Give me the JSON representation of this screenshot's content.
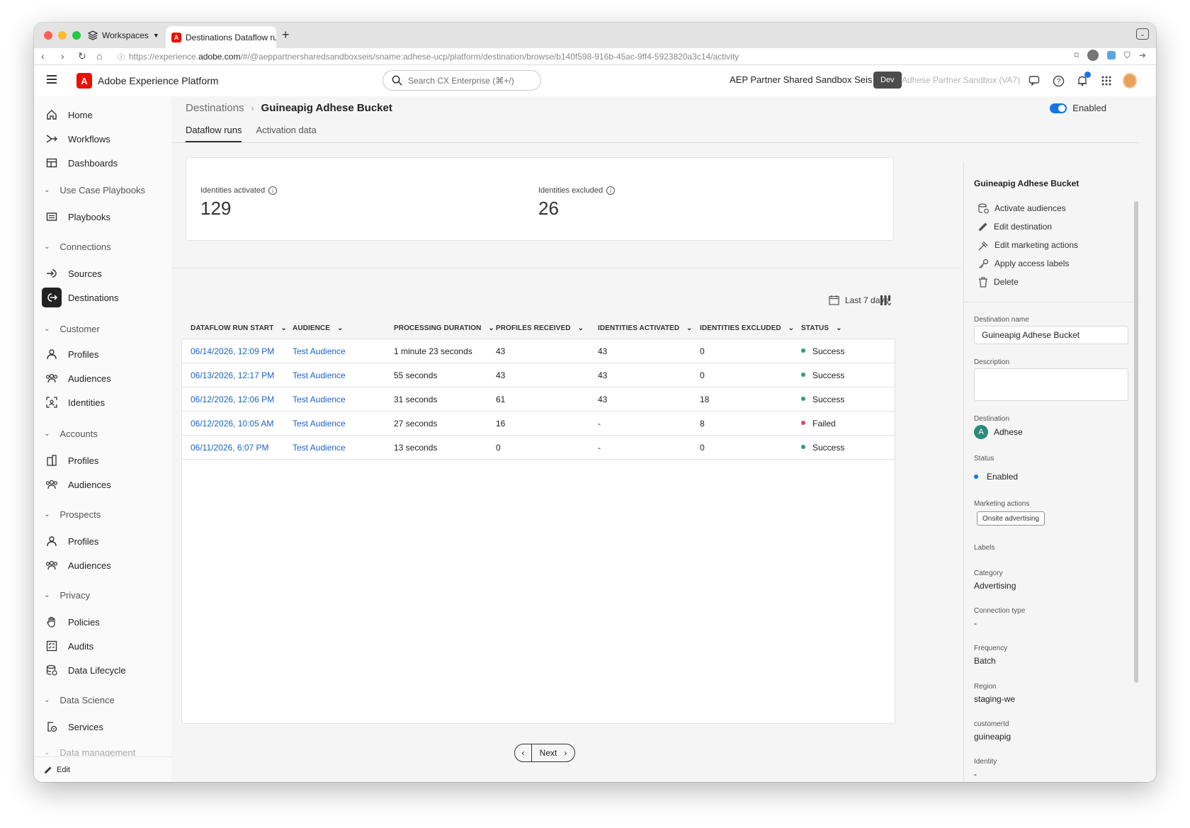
{
  "browser": {
    "workspaces_label": "Workspaces",
    "tab_title": "Destinations Dataflow runs",
    "new_tab_symbol": "+",
    "url_prefix": "https://experience.",
    "url_host": "adobe.com",
    "url_path": "/#/@aeppartnersharedsandboxseis/sname:adhese-ucp/platform/destination/browse/b140f598-916b-45ac-9ff4-5923820a3c14/activity"
  },
  "header": {
    "app_name": "Adobe Experience Platform",
    "search_placeholder": "Search CX Enterprise (⌘+/)",
    "org_name": "AEP Partner Shared Sandbox Seis",
    "sandbox_badge": "Dev",
    "sandbox_name": "Adhese Partner Sandbox (VA7)"
  },
  "sidenav": {
    "items": [
      {
        "label": "Home",
        "icon": "home-icon"
      },
      {
        "label": "Workflows",
        "icon": "workflows-icon"
      },
      {
        "label": "Dashboards",
        "icon": "dashboards-icon"
      },
      {
        "label": "Playbooks",
        "icon": "playbooks-icon"
      },
      {
        "label": "Sources",
        "icon": "sources-icon"
      },
      {
        "label": "Destinations",
        "icon": "destinations-icon",
        "active": true
      },
      {
        "label": "Profiles",
        "icon": "user-icon"
      },
      {
        "label": "Audiences",
        "icon": "audiences-icon"
      },
      {
        "label": "Identities",
        "icon": "identities-icon"
      },
      {
        "label": "Profiles",
        "icon": "building-icon"
      },
      {
        "label": "Audiences",
        "icon": "audiences-icon"
      },
      {
        "label": "Profiles",
        "icon": "user-icon"
      },
      {
        "label": "Audiences",
        "icon": "audiences-icon"
      },
      {
        "label": "Policies",
        "icon": "hand-icon"
      },
      {
        "label": "Audits",
        "icon": "audits-icon"
      },
      {
        "label": "Data Lifecycle",
        "icon": "data-lifecycle-icon"
      },
      {
        "label": "Services",
        "icon": "services-icon"
      }
    ],
    "sections": [
      "Use Case Playbooks",
      "Connections",
      "Customer",
      "Accounts",
      "Prospects",
      "Privacy",
      "Data Science",
      "Data management"
    ],
    "footer_label": "Edit"
  },
  "page": {
    "breadcrumb_parent": "Destinations",
    "breadcrumb_current": "Guineapig Adhese Bucket",
    "enabled_label": "Enabled",
    "tabs": [
      "Dataflow runs",
      "Activation data"
    ]
  },
  "stats": {
    "activated_label": "Identities activated",
    "activated_value": "129",
    "excluded_label": "Identities excluded",
    "excluded_value": "26"
  },
  "filter": {
    "range_label": "Last 7 days"
  },
  "table": {
    "columns": [
      "DATAFLOW RUN START",
      "AUDIENCE",
      "PROCESSING DURATION",
      "PROFILES RECEIVED",
      "IDENTITIES ACTIVATED",
      "IDENTITIES EXCLUDED",
      "STATUS"
    ],
    "rows": [
      {
        "start": "06/14/2026, 12:09 PM",
        "audience": "Test Audience",
        "duration": "1 minute 23 seconds",
        "received": "43",
        "activated": "43",
        "excluded": "0",
        "status": "Success"
      },
      {
        "start": "06/13/2026, 12:17 PM",
        "audience": "Test Audience",
        "duration": "55 seconds",
        "received": "43",
        "activated": "43",
        "excluded": "0",
        "status": "Success"
      },
      {
        "start": "06/12/2026, 12:06 PM",
        "audience": "Test Audience",
        "duration": "31 seconds",
        "received": "61",
        "activated": "43",
        "excluded": "18",
        "status": "Success"
      },
      {
        "start": "06/12/2026, 10:05 AM",
        "audience": "Test Audience",
        "duration": "27 seconds",
        "received": "16",
        "activated": "-",
        "excluded": "8",
        "status": "Failed"
      },
      {
        "start": "06/11/2026, 6:07 PM",
        "audience": "Test Audience",
        "duration": "13 seconds",
        "received": "0",
        "activated": "-",
        "excluded": "0",
        "status": "Success"
      }
    ],
    "status_colors": {
      "Success": "#2d9d78",
      "Failed": "#e34850"
    }
  },
  "pager": {
    "next_label": "Next"
  },
  "rail": {
    "title": "Guineapig Adhese Bucket",
    "actions": [
      "Activate audiences",
      "Edit destination",
      "Edit marketing actions",
      "Apply access labels",
      "Delete"
    ],
    "destination_name_label": "Destination name",
    "destination_name_value": "Guineapig Adhese Bucket",
    "description_label": "Description",
    "description_value": "",
    "destination_label": "Destination",
    "destination_value": "Adhese",
    "destination_initial": "A",
    "status_label": "Status",
    "status_value": "Enabled",
    "marketing_label": "Marketing actions",
    "marketing_tag": "Onsite advertising",
    "labels_label": "Labels",
    "category_label": "Category",
    "category_value": "Advertising",
    "connection_label": "Connection type",
    "connection_value": "-",
    "frequency_label": "Frequency",
    "frequency_value": "Batch",
    "region_label": "Region",
    "region_value": "staging-we",
    "customer_label": "customerId",
    "customer_value": "guineapig",
    "identity_label": "Identity",
    "identity_value": "-"
  },
  "colors": {
    "accent": "#1473e6",
    "link": "#1d63c7",
    "brand": "#eb1000"
  }
}
